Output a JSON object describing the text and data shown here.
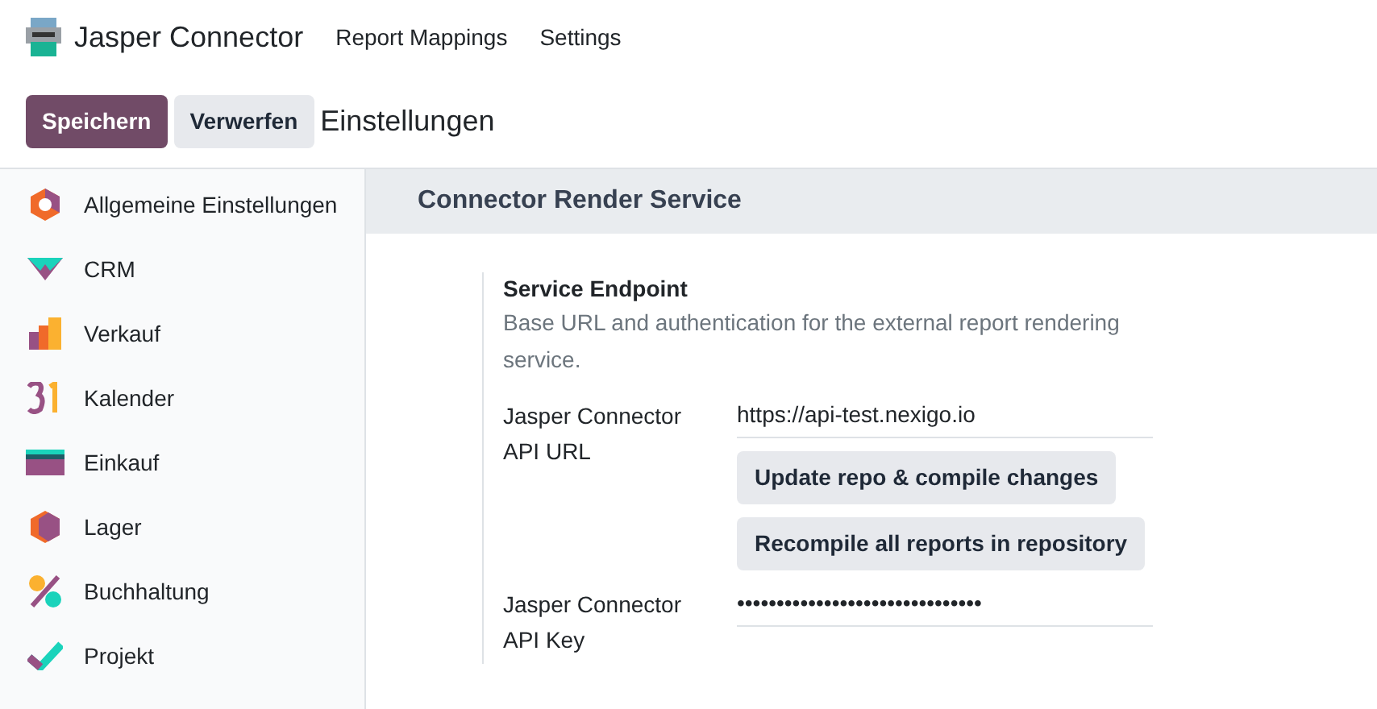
{
  "navbar": {
    "app_name": "Jasper Connector",
    "menu": [
      "Report Mappings",
      "Settings"
    ]
  },
  "control_bar": {
    "buttons": [
      {
        "label": "Speichern",
        "kind": "primary"
      },
      {
        "label": "Verwerfen",
        "kind": "secondary"
      }
    ],
    "breadcrumb": "Einstellungen"
  },
  "sidebar": {
    "items": [
      {
        "label": "Allgemeine Einstellungen"
      },
      {
        "label": "CRM"
      },
      {
        "label": "Verkauf"
      },
      {
        "label": "Kalender"
      },
      {
        "label": "Einkauf"
      },
      {
        "label": "Lager"
      },
      {
        "label": "Buchhaltung"
      },
      {
        "label": "Projekt"
      }
    ]
  },
  "section": {
    "title": "Connector Render Service",
    "setting": {
      "title": "Service Endpoint",
      "description": "Base URL and authentication for the external report rendering service.",
      "fields": [
        {
          "label": "Jasper Connector API URL",
          "value": "https://api-test.nexigo.io",
          "buttons": [
            "Update repo & compile changes",
            "Recompile all reports in repository"
          ]
        },
        {
          "label": "Jasper Connector API Key",
          "value": "•••••••••••••••••••••••••••••••"
        }
      ]
    }
  }
}
